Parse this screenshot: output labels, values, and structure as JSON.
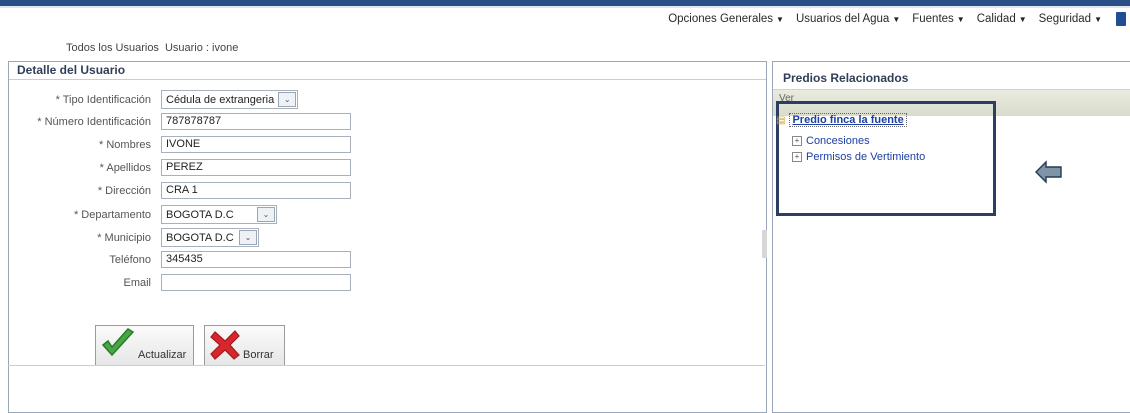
{
  "menu": {
    "items": [
      {
        "label": "Opciones Generales"
      },
      {
        "label": "Usuarios del Agua"
      },
      {
        "label": "Fuentes"
      },
      {
        "label": "Calidad"
      },
      {
        "label": "Seguridad"
      }
    ]
  },
  "breadcrumbs": {
    "all_users": "Todos los Usuarios",
    "current": "Usuario : ivone"
  },
  "user_detail": {
    "title": "Detalle del Usuario",
    "fields": {
      "tipo_id": {
        "label": "* Tipo Identificación",
        "value": "Cédula de extrangeria"
      },
      "numero_id": {
        "label": "* Número Identificación",
        "value": "787878787"
      },
      "nombres": {
        "label": "* Nombres",
        "value": "IVONE"
      },
      "apellidos": {
        "label": "* Apellidos",
        "value": "PEREZ"
      },
      "direccion": {
        "label": "* Dirección",
        "value": "CRA 1"
      },
      "departamento": {
        "label": "* Departamento",
        "value": "BOGOTA D.C"
      },
      "municipio": {
        "label": "* Municipio",
        "value": "BOGOTA D.C"
      },
      "telefono": {
        "label": "Teléfono",
        "value": "345435"
      },
      "email": {
        "label": "Email",
        "value": ""
      }
    },
    "buttons": {
      "actualizar": "Actualizar",
      "borrar": "Borrar"
    }
  },
  "related": {
    "title": "Predios Relacionados",
    "view_menu": "Ver",
    "tree_root": "Predio finca la fuente",
    "children": [
      "Concesiones",
      "Permisos de Vertimiento"
    ]
  },
  "colors": {
    "brand": "#2a4f86",
    "link": "#1b3fa3",
    "highlight_border": "#2b3f61"
  }
}
